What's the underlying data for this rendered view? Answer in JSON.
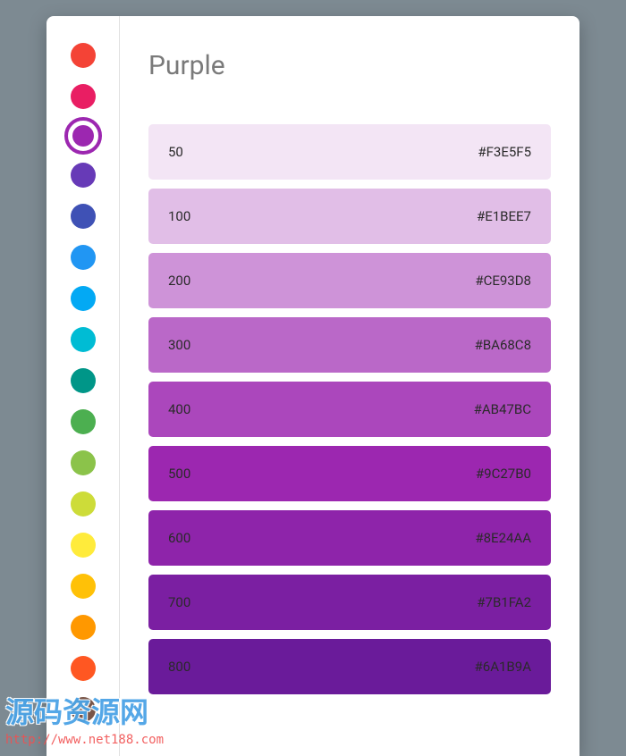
{
  "title": "Purple",
  "selected_index": 2,
  "sidebar": {
    "swatches": [
      {
        "color": "#f44336"
      },
      {
        "color": "#e91e63"
      },
      {
        "color": "#9c27b0"
      },
      {
        "color": "#673ab7"
      },
      {
        "color": "#3f51b5"
      },
      {
        "color": "#2196f3"
      },
      {
        "color": "#03a9f4"
      },
      {
        "color": "#00bcd4"
      },
      {
        "color": "#009688"
      },
      {
        "color": "#4caf50"
      },
      {
        "color": "#8bc34a"
      },
      {
        "color": "#cddc39"
      },
      {
        "color": "#ffeb3b"
      },
      {
        "color": "#ffc107"
      },
      {
        "color": "#ff9800"
      },
      {
        "color": "#ff5722"
      },
      {
        "color": "#795548"
      }
    ]
  },
  "shades": [
    {
      "level": "50",
      "hex": "#F3E5F5",
      "bg": "#F3E5F5"
    },
    {
      "level": "100",
      "hex": "#E1BEE7",
      "bg": "#E1BEE7"
    },
    {
      "level": "200",
      "hex": "#CE93D8",
      "bg": "#CE93D8"
    },
    {
      "level": "300",
      "hex": "#BA68C8",
      "bg": "#BA68C8"
    },
    {
      "level": "400",
      "hex": "#AB47BC",
      "bg": "#AB47BC"
    },
    {
      "level": "500",
      "hex": "#9C27B0",
      "bg": "#9C27B0"
    },
    {
      "level": "600",
      "hex": "#8E24AA",
      "bg": "#8E24AA"
    },
    {
      "level": "700",
      "hex": "#7B1FA2",
      "bg": "#7B1FA2"
    },
    {
      "level": "800",
      "hex": "#6A1B9A",
      "bg": "#6A1B9A"
    }
  ],
  "watermark": {
    "text": "源码资源网",
    "url": "http://www.net188.com"
  }
}
